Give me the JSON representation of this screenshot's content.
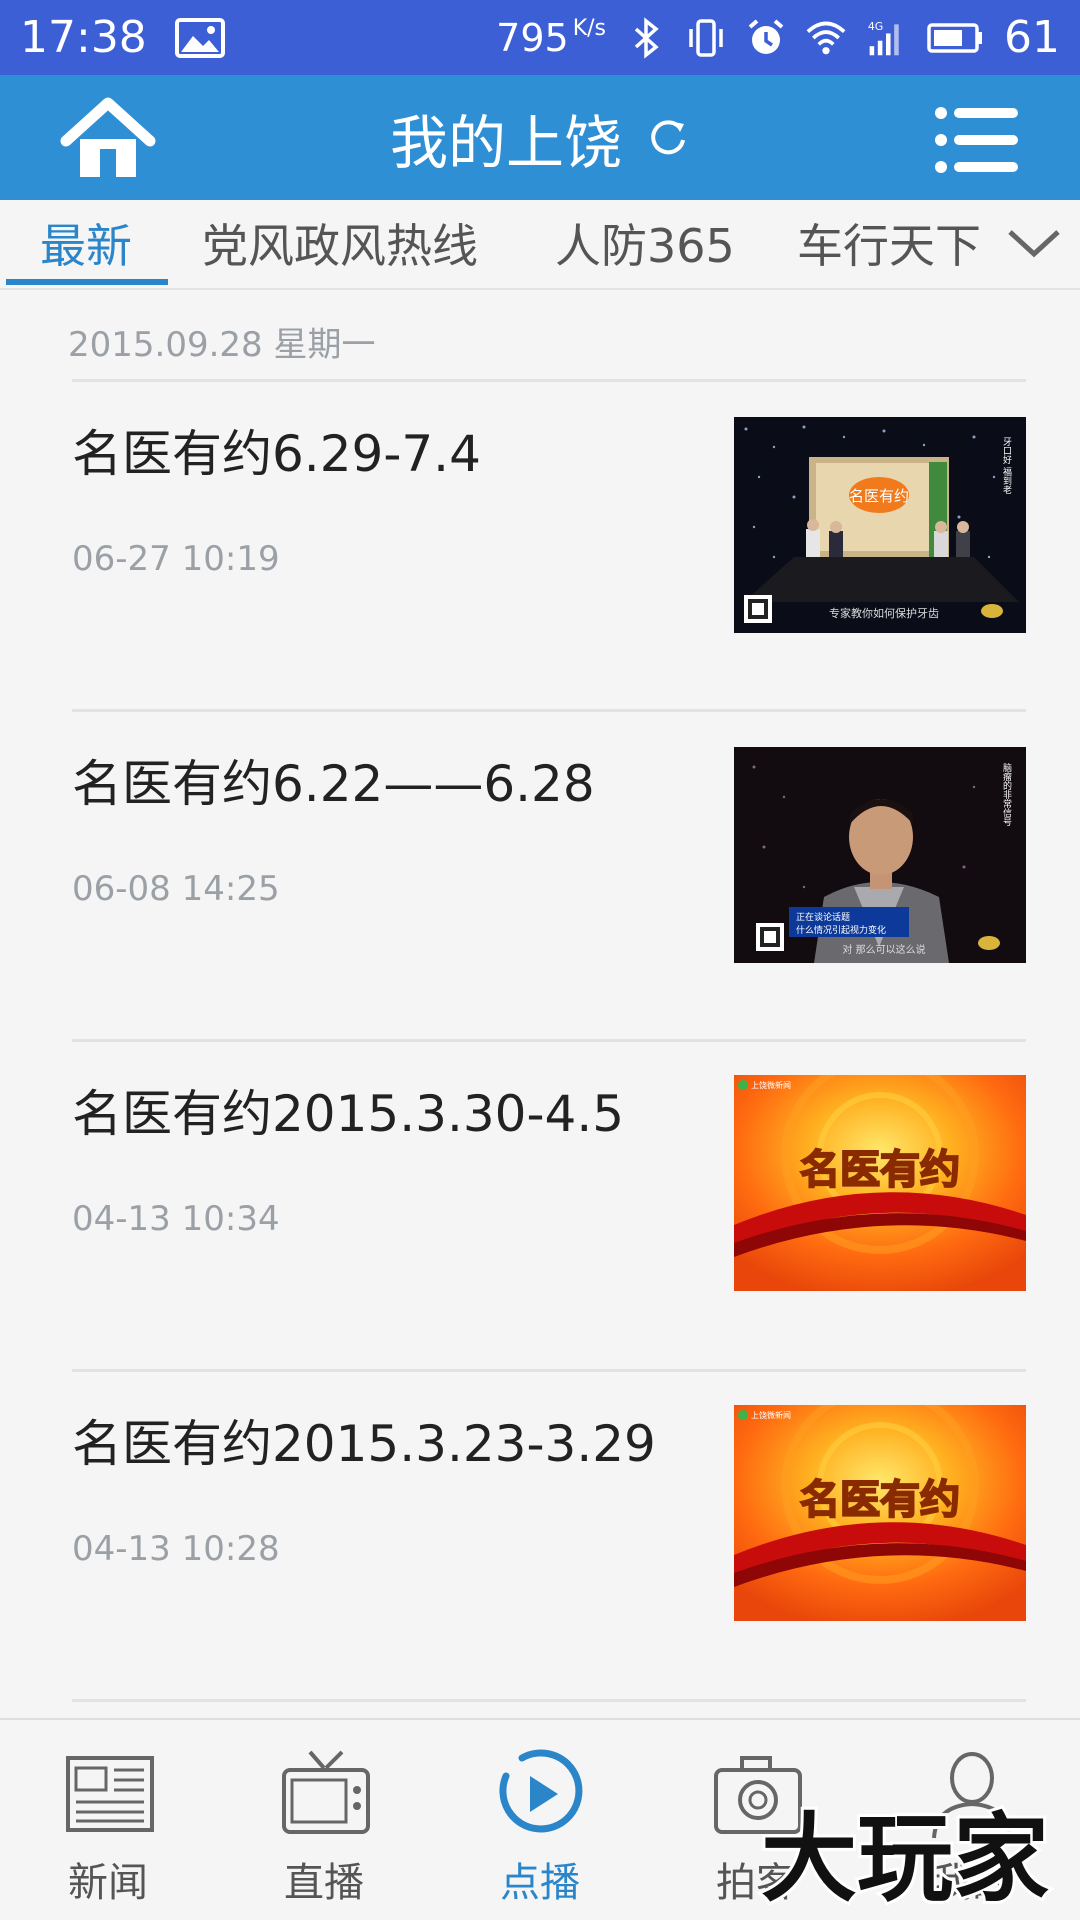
{
  "status_bar": {
    "time": "17:38",
    "net_speed": "795",
    "net_speed_unit": "K/s",
    "battery_percent": "61",
    "icons": [
      "image-icon",
      "bluetooth-icon",
      "vibrate-icon",
      "alarm-icon",
      "wifi-icon",
      "signal-4g-icon",
      "battery-icon"
    ]
  },
  "header": {
    "title": "我的上饶",
    "icons": [
      "home-icon",
      "refresh-icon",
      "menu-icon"
    ],
    "background": "#2e8fd4"
  },
  "tabs": [
    {
      "label": "最新",
      "active": true
    },
    {
      "label": "党风政风热线",
      "active": false
    },
    {
      "label": "人防365",
      "active": false
    },
    {
      "label": "车行天下",
      "active": false
    }
  ],
  "list": {
    "section_date": "2015.09.28 星期一",
    "items": [
      {
        "title": "名医有约6.29-7.4",
        "meta": "06-27 10:19",
        "thumb": "studio-interview"
      },
      {
        "title": "名医有约6.22——6.28",
        "meta": "06-08 14:25",
        "thumb": "guest-closeup"
      },
      {
        "title": "名医有约2015.3.30-4.5",
        "meta": "04-13 10:34",
        "thumb": "title-card"
      },
      {
        "title": "名医有约2015.3.23-3.29",
        "meta": "04-13 10:28",
        "thumb": "title-card"
      }
    ],
    "thumb_texts": {
      "studio_logo": "名医有约",
      "side_caption": "牙口好 福到老",
      "subtitle1": "专家教你如何保护牙齿",
      "side_caption2": "脑瘤的非常信号",
      "lower_third": "正在谈论话题",
      "lower_third2": "什么情况引起视力变化",
      "subtitle2": "对 那么可以这么说",
      "card_title": "名医有约",
      "card_brand": "上饶微新闻"
    }
  },
  "bottom_nav": [
    {
      "label": "新闻",
      "icon": "newspaper-icon",
      "active": false
    },
    {
      "label": "直播",
      "icon": "tv-icon",
      "active": false
    },
    {
      "label": "点播",
      "icon": "play-icon",
      "active": true
    },
    {
      "label": "拍客",
      "icon": "camera-icon",
      "active": false
    },
    {
      "label": "我的",
      "icon": "user-icon",
      "active": false
    }
  ],
  "watermark": "大玩家",
  "colors": {
    "status_bar": "#3d5fd6",
    "accent": "#2a86c9",
    "text_muted": "#9aa0a6"
  }
}
